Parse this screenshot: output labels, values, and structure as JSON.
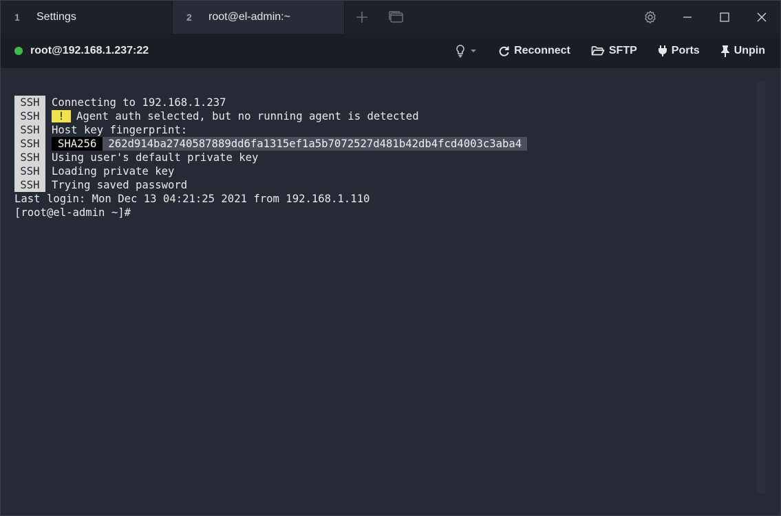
{
  "tabs": [
    {
      "number": "1",
      "label": "Settings"
    },
    {
      "number": "2",
      "label": "root@el-admin:~"
    }
  ],
  "toolbar": {
    "host": "root@192.168.1.237:22",
    "reconnect": "Reconnect",
    "sftp": "SFTP",
    "ports": "Ports",
    "unpin": "Unpin"
  },
  "terminal": {
    "ssh_tag": "SSH",
    "warn_tag": "!",
    "sha_tag": "SHA256",
    "lines": {
      "connecting": "Connecting to 192.168.1.237",
      "agent": "Agent auth selected, but no running agent is detected",
      "fingerprint_label": "Host key fingerprint:",
      "fingerprint": "262d914ba2740587889dd6fa1315ef1a5b7072527d481b42db4fcd4003c3aba4",
      "default_key": "Using user's default private key",
      "loading": "Loading private key",
      "trying": "Trying saved password",
      "last_login": "Last login: Mon Dec 13 04:21:25 2021 from 192.168.1.110",
      "prompt": "[root@el-admin ~]#"
    }
  },
  "colors": {
    "status": "#3dbb4c",
    "warn": "#f2e24b",
    "background": "#252a34"
  }
}
